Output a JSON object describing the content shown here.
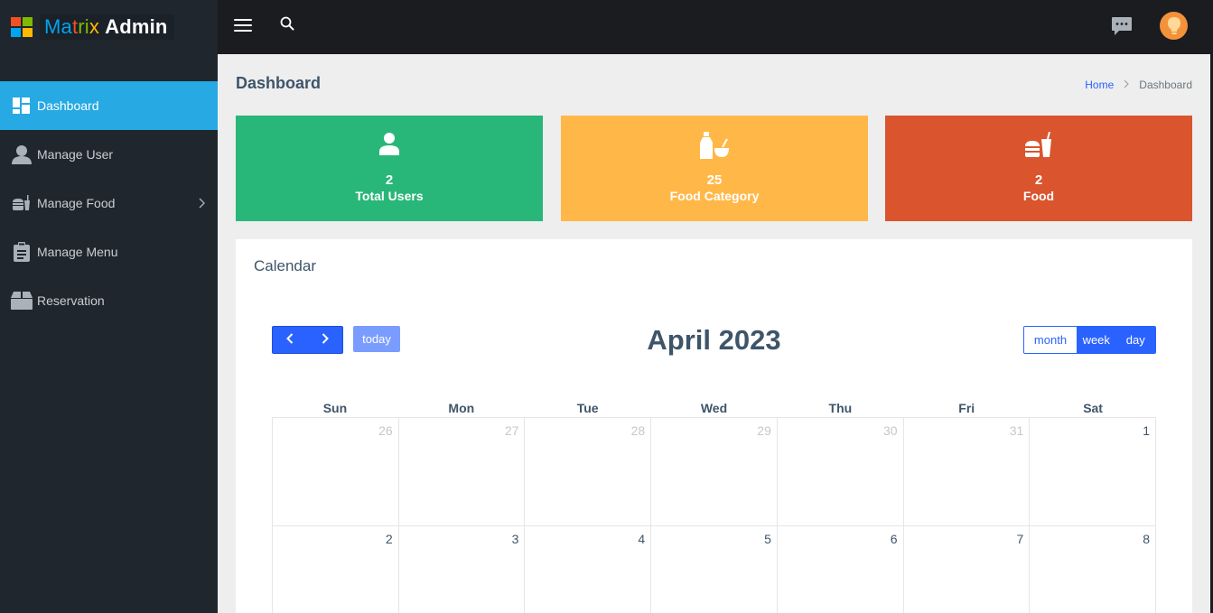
{
  "brand": {
    "part1": "Ma",
    "part2": "t",
    "part3": "ri",
    "part4": "x",
    "bold": "Admin"
  },
  "brand_colors": {
    "red": "#f25022",
    "green": "#7fba00",
    "blue": "#00a4ef",
    "yellow": "#ffb900"
  },
  "sidebar": {
    "items": [
      {
        "label": "Dashboard",
        "icon": "dashboard-icon",
        "active": true
      },
      {
        "label": "Manage User",
        "icon": "user-icon"
      },
      {
        "label": "Manage Food",
        "icon": "food-icon",
        "has_submenu": true
      },
      {
        "label": "Manage Menu",
        "icon": "clipboard-icon"
      },
      {
        "label": "Reservation",
        "icon": "box-icon"
      }
    ]
  },
  "topbar": {
    "icons": [
      "menu-icon",
      "search-icon",
      "chat-icon",
      "avatar-icon"
    ]
  },
  "page": {
    "title": "Dashboard",
    "breadcrumb": {
      "home": "Home",
      "separator": ">",
      "current": "Dashboard"
    }
  },
  "cards": [
    {
      "count": "2",
      "label": "Total Users",
      "icon": "user-icon",
      "color": "#28b779"
    },
    {
      "count": "25",
      "label": "Food Category",
      "icon": "bottle-bowl-icon",
      "color": "#ffb848"
    },
    {
      "count": "2",
      "label": "Food",
      "icon": "burger-drink-icon",
      "color": "#da542e"
    }
  ],
  "calendar": {
    "heading": "Calendar",
    "title": "April 2023",
    "today_label": "today",
    "views": [
      "month",
      "week",
      "day"
    ],
    "active_view": "month",
    "days_of_week": [
      "Sun",
      "Mon",
      "Tue",
      "Wed",
      "Thu",
      "Fri",
      "Sat"
    ],
    "weeks": [
      [
        "26",
        "27",
        "28",
        "29",
        "30",
        "31",
        "1"
      ],
      [
        "2",
        "3",
        "4",
        "5",
        "6",
        "7",
        "8"
      ]
    ]
  },
  "colors": {
    "sidebar_bg": "#1f262d",
    "topbar_bg": "#1a1c1f",
    "active_nav": "#27a9e3",
    "primary": "#2962ff"
  }
}
